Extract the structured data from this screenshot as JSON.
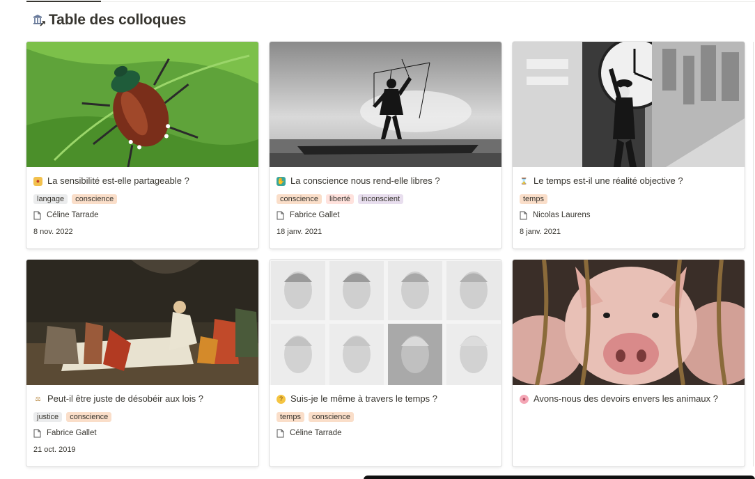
{
  "header": {
    "title": "Table des colloques",
    "icon": "columns-building-icon"
  },
  "colors": {
    "tag_langage": "#ebeced",
    "tag_conscience": "#fadec9",
    "tag_liberte": "#ffe2dd",
    "tag_inconscient": "#e8deee",
    "tag_temps": "#fadec9",
    "tag_justice": "#ebeced"
  },
  "cards": [
    {
      "title": "La sensibilité est-elle partageable ?",
      "emoji": "mask-emoji",
      "cover": "beetle-on-leaf",
      "tags": [
        {
          "label": "langage",
          "color": "#ebeced"
        },
        {
          "label": "conscience",
          "color": "#fadec9"
        }
      ],
      "author": "Céline Tarrade",
      "date": "8 nov. 2022"
    },
    {
      "title": "La conscience nous rend-elle libres ?",
      "emoji": "hand-emoji",
      "cover": "puppet-man",
      "tags": [
        {
          "label": "conscience",
          "color": "#fadec9"
        },
        {
          "label": "liberté",
          "color": "#ffe2dd"
        },
        {
          "label": "inconscient",
          "color": "#e8deee"
        }
      ],
      "author": "Fabrice Gallet",
      "date": "18 janv. 2021"
    },
    {
      "title": "Le temps est-il une réalité objective ?",
      "emoji": "hourglass-emoji",
      "cover": "clock-hanging-man",
      "tags": [
        {
          "label": "temps",
          "color": "#fadec9"
        }
      ],
      "author": "Nicolas Laurens",
      "date": "8 janv. 2021"
    },
    {
      "title": "Peut-il être juste de désobéir aux lois ?",
      "emoji": "scales-emoji",
      "cover": "death-of-socrates-painting",
      "tags": [
        {
          "label": "justice",
          "color": "#ebeced"
        },
        {
          "label": "conscience",
          "color": "#fadec9"
        }
      ],
      "author": "Fabrice Gallet",
      "date": "21 oct. 2019"
    },
    {
      "title": "Suis-je le même à travers le temps ?",
      "emoji": "thinking-face-emoji",
      "cover": "aging-portraits-grid",
      "tags": [
        {
          "label": "temps",
          "color": "#fadec9"
        },
        {
          "label": "conscience",
          "color": "#fadec9"
        }
      ],
      "author": "Céline Tarrade",
      "date": ""
    },
    {
      "title": "Avons-nous des devoirs envers les animaux ?",
      "emoji": "pig-face-emoji",
      "cover": "pigs-behind-bars",
      "tags": [],
      "author": "",
      "date": ""
    }
  ]
}
